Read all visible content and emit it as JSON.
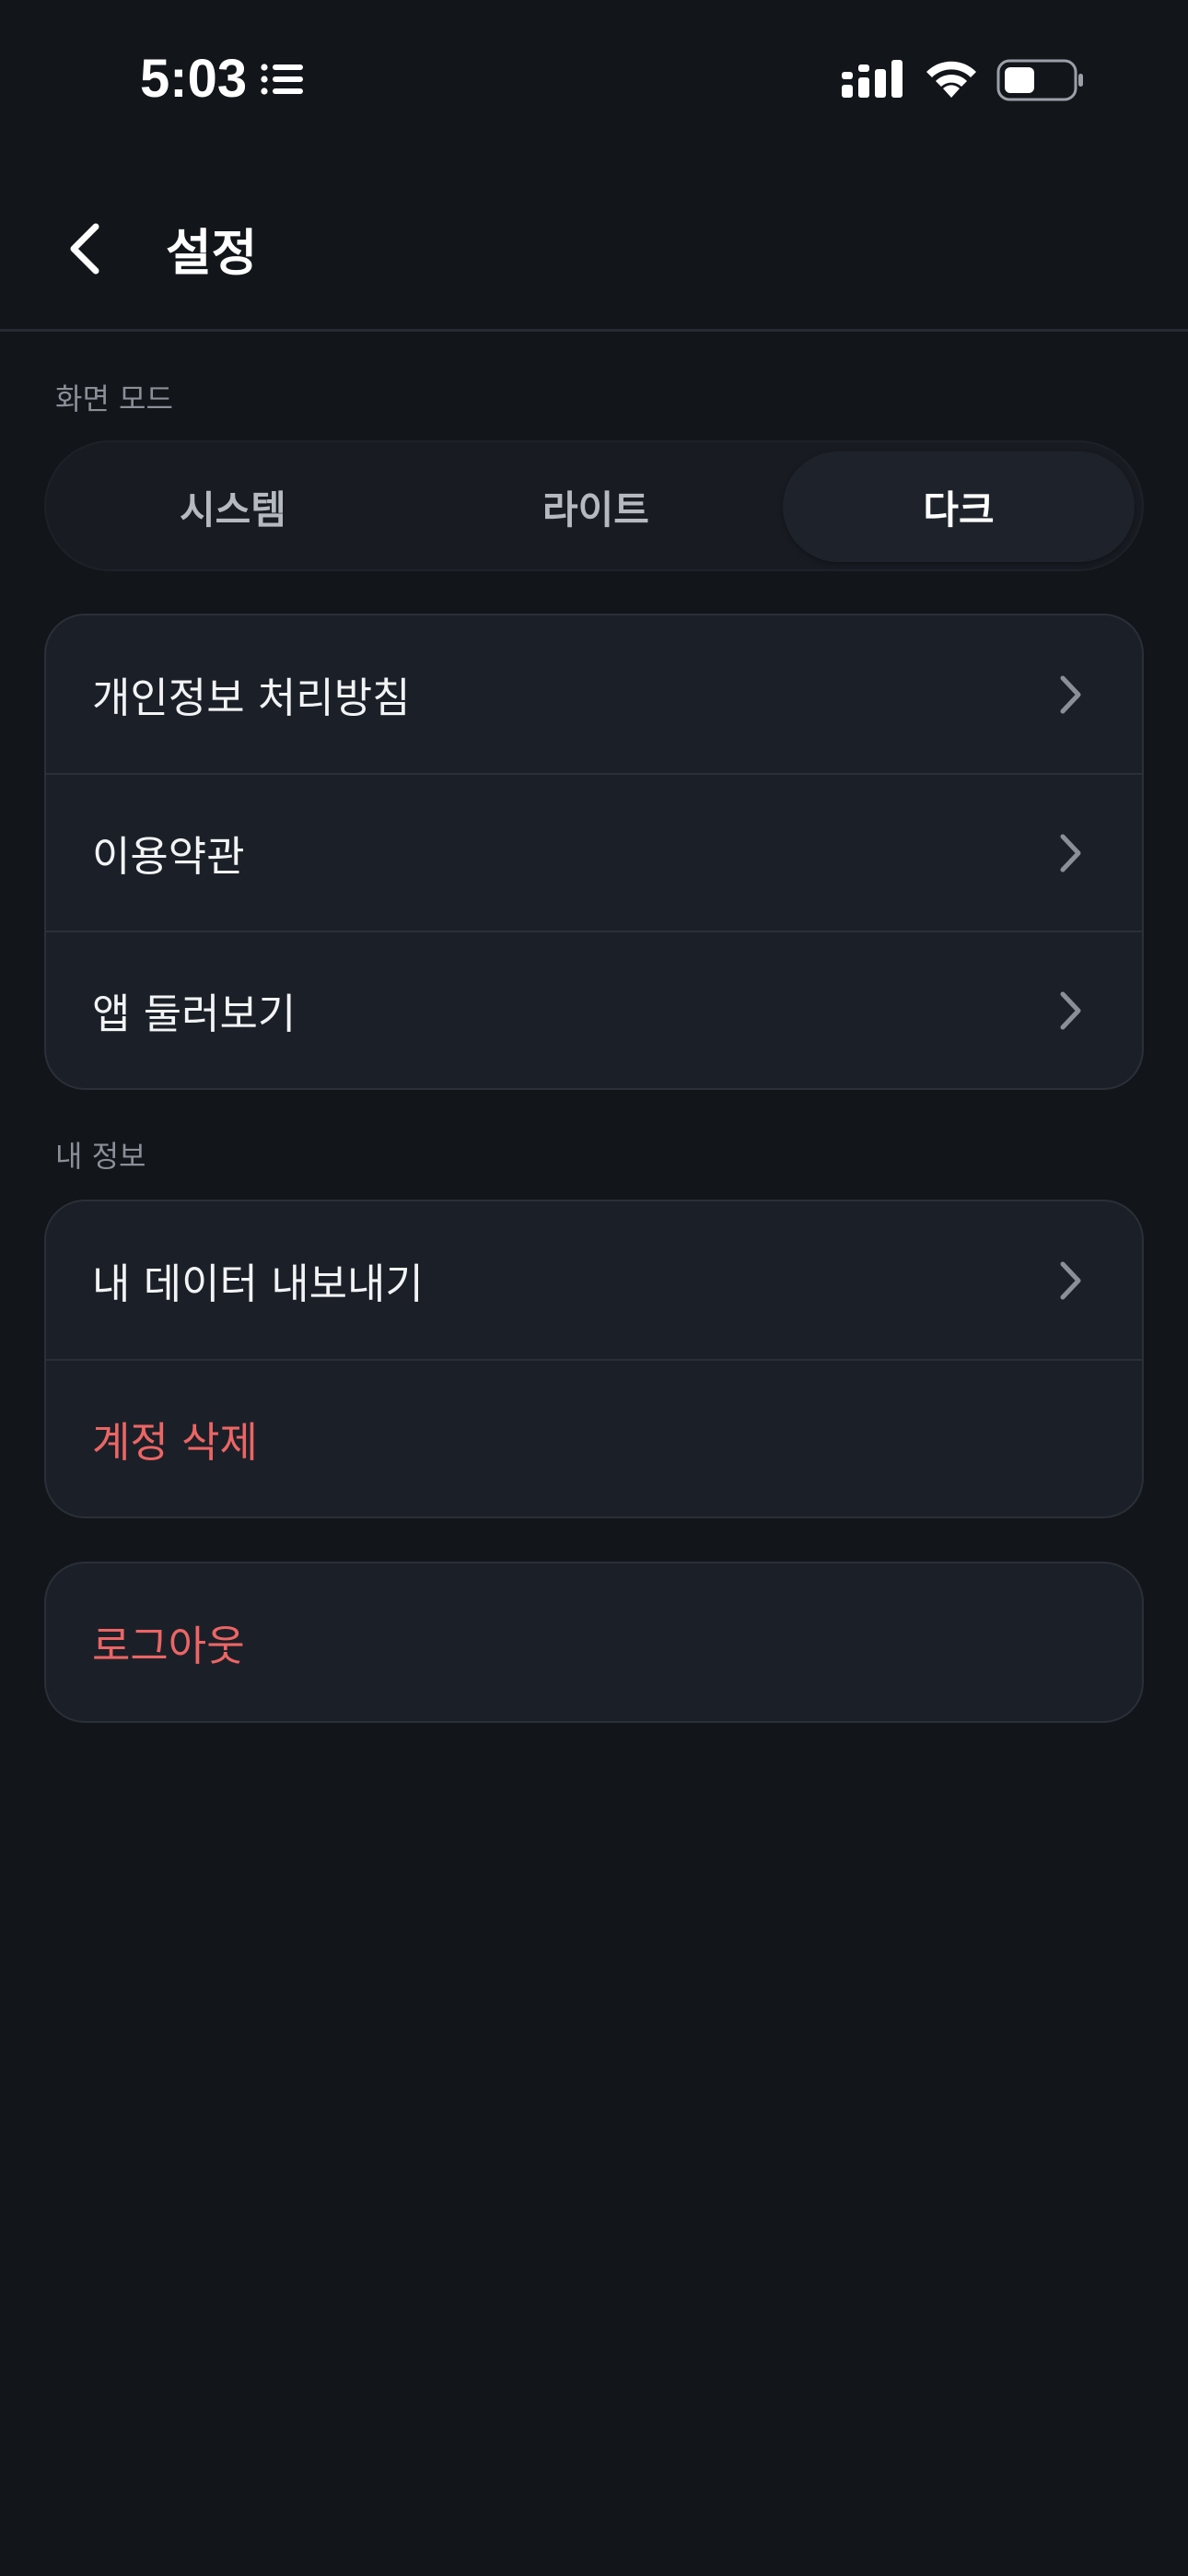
{
  "status_bar": {
    "time": "5:03",
    "icons": [
      "list-icon",
      "signal-icon",
      "wifi-icon",
      "battery-icon"
    ]
  },
  "header": {
    "title": "설정",
    "back_icon": "chevron-left-icon"
  },
  "display_mode": {
    "label": "화면 모드",
    "options": [
      "시스템",
      "라이트",
      "다크"
    ],
    "selected": "다크"
  },
  "info_menu": {
    "items": [
      {
        "label": "개인정보 처리방침",
        "icon": "chevron-right-icon"
      },
      {
        "label": "이용약관",
        "icon": "chevron-right-icon"
      },
      {
        "label": "앱 둘러보기",
        "icon": "chevron-right-icon"
      }
    ]
  },
  "my_info": {
    "label": "내 정보",
    "items": [
      {
        "label": "내 데이터 내보내기",
        "icon": "chevron-right-icon"
      },
      {
        "label": "계정 삭제"
      }
    ]
  },
  "logout": {
    "label": "로그아웃"
  },
  "colors": {
    "background": "#121519",
    "card": "#1b2028",
    "danger": "#ec6565",
    "muted": "#8a8f98"
  }
}
